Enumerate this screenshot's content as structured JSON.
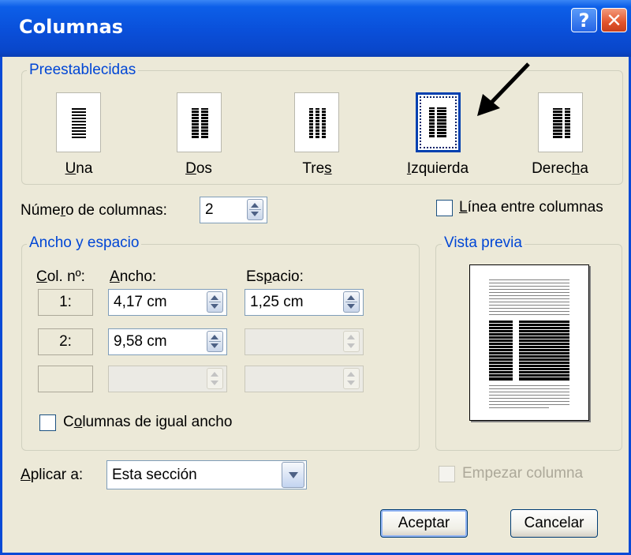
{
  "window": {
    "title": "Columnas",
    "help_label": "?",
    "close_label": "✕"
  },
  "presets": {
    "group_title": "Preestablecidas",
    "items": [
      {
        "label_pre": "",
        "label_u": "U",
        "label_post": "na",
        "icon": "one-column-icon"
      },
      {
        "label_pre": "",
        "label_u": "D",
        "label_post": "os",
        "icon": "two-columns-icon"
      },
      {
        "label_pre": "Tre",
        "label_u": "s",
        "label_post": "",
        "icon": "three-columns-icon"
      },
      {
        "label_pre": "",
        "label_u": "I",
        "label_post": "zquierda",
        "icon": "left-column-icon",
        "selected": true
      },
      {
        "label_pre": "Derec",
        "label_u": "h",
        "label_post": "a",
        "icon": "right-column-icon"
      }
    ]
  },
  "num_columns": {
    "label_pre": "Núme",
    "label_u": "r",
    "label_post": "o de columnas:",
    "value": "2"
  },
  "line_between": {
    "label_pre": "",
    "label_u": "L",
    "label_post": "ínea entre columnas",
    "checked": false
  },
  "width_spacing": {
    "group_title": "Ancho y espacio",
    "col_header_pre": "",
    "col_header_u": "C",
    "col_header_post": "ol. nº:",
    "width_header_pre": "",
    "width_header_u": "A",
    "width_header_post": "ncho:",
    "spacing_header_pre": "Es",
    "spacing_header_u": "p",
    "spacing_header_post": "acio:",
    "rows": [
      {
        "col": "1:",
        "width": "4,17 cm",
        "spacing": "1,25 cm"
      },
      {
        "col": "2:",
        "width": "9,58 cm",
        "spacing": ""
      },
      {
        "col": "",
        "width": "",
        "spacing": ""
      }
    ],
    "equal_width_pre": "C",
    "equal_width_u": "o",
    "equal_width_post": "lumnas de igual ancho"
  },
  "preview": {
    "group_title": "Vista previa"
  },
  "apply_to": {
    "label_pre": "",
    "label_u": "A",
    "label_post": "plicar a:",
    "value": "Esta sección"
  },
  "start_column": {
    "label": "Empezar columna",
    "enabled": false
  },
  "buttons": {
    "ok": "Aceptar",
    "cancel": "Cancelar"
  },
  "colors": {
    "title_bar": "#0a4fd9",
    "dialog_bg": "#ece9d8",
    "group_title": "#0046d5"
  }
}
